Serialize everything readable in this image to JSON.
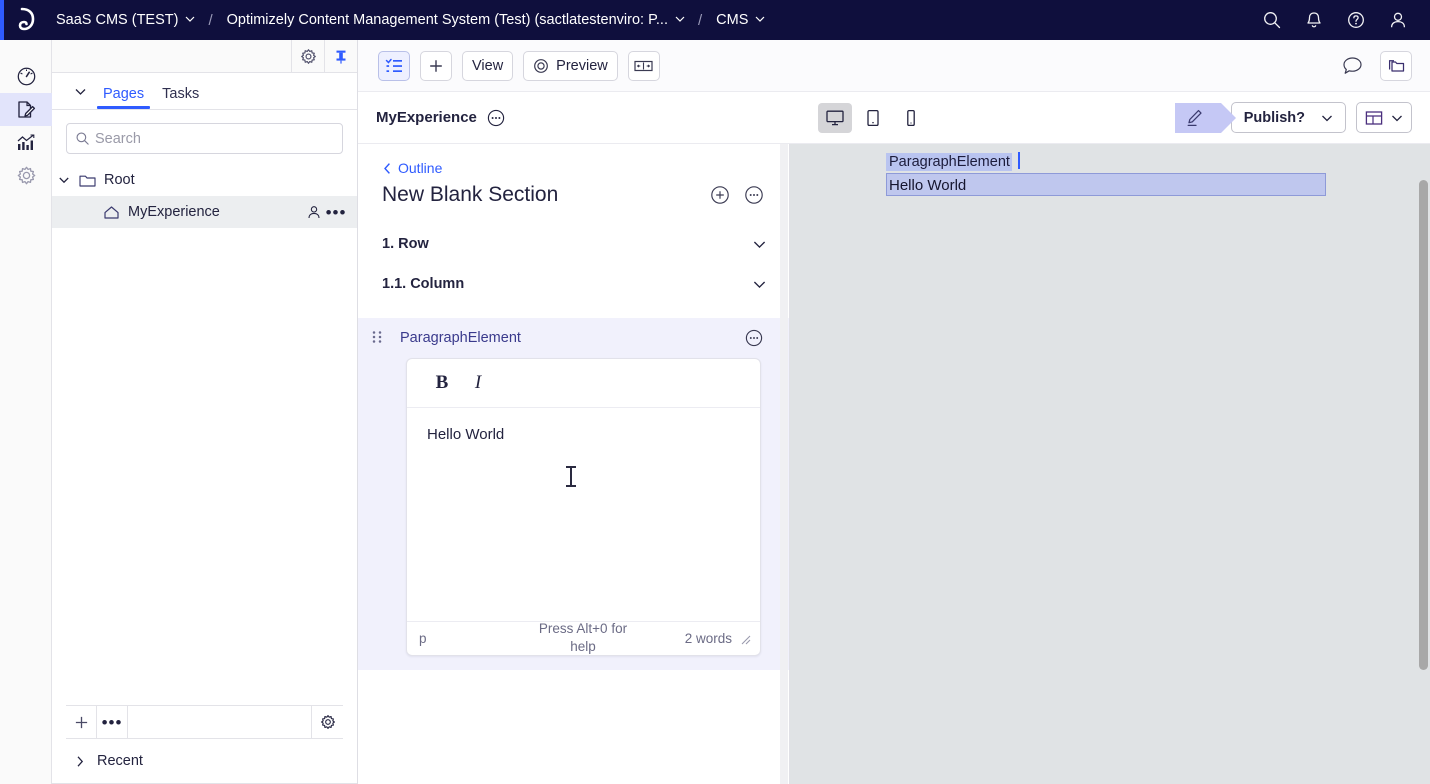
{
  "topbar": {
    "logo_icon": "optimizely-logo-icon",
    "breadcrumbs": [
      {
        "label": "SaaS CMS (TEST)",
        "has_chevron": true
      },
      {
        "label": "Optimizely Content Management System (Test) (sactlatestenviro: P...",
        "has_chevron": true
      },
      {
        "label": "CMS",
        "has_chevron": true
      }
    ],
    "separator": "/",
    "actions": [
      {
        "name": "search-icon",
        "label": "Search"
      },
      {
        "name": "notifications-icon",
        "label": "Notifications"
      },
      {
        "name": "help-icon",
        "label": "Help"
      },
      {
        "name": "user-account-icon",
        "label": "Account"
      }
    ]
  },
  "rail": {
    "items": [
      {
        "name": "dashboard-icon",
        "label": "Dashboard",
        "active": false
      },
      {
        "name": "content-edit-icon",
        "label": "Edit",
        "active": true
      },
      {
        "name": "analytics-icon",
        "label": "Analytics",
        "active": false
      },
      {
        "name": "settings-gear-icon",
        "label": "Settings",
        "active": false
      }
    ]
  },
  "sidebar": {
    "tools": [
      {
        "name": "panel-settings-icon",
        "label": "Settings"
      },
      {
        "name": "pin-panel-icon",
        "label": "Pin"
      }
    ],
    "tabs": [
      {
        "label": "Pages",
        "active": true
      },
      {
        "label": "Tasks",
        "active": false
      }
    ],
    "search": {
      "value": "",
      "placeholder": "Search"
    },
    "tree": [
      {
        "label": "Root",
        "icon": "folder-icon",
        "expanded": true,
        "selected": false,
        "depth": 0
      },
      {
        "label": "MyExperience",
        "icon": "home-icon",
        "selected": true,
        "depth": 1
      }
    ],
    "bottom_bar": {
      "add_label": "+",
      "more_label": "•••",
      "gear_name": "sidebar-gear-icon",
      "field_value": ""
    },
    "recent": {
      "label": "Recent",
      "expanded": false
    }
  },
  "editor": {
    "toolbar": {
      "outline_toggle": {
        "name": "outline-toggle-icon",
        "active": true
      },
      "add_label": "+",
      "view_label": "View",
      "preview_label": "Preview",
      "split_name": "split-view-icon",
      "comments_name": "comments-icon",
      "assets_name": "assets-panel-icon"
    },
    "subbar": {
      "title": "MyExperience",
      "title_menu": "•••",
      "devices": [
        {
          "name": "desktop-icon",
          "label": "Desktop",
          "active": true
        },
        {
          "name": "tablet-icon",
          "label": "Tablet",
          "active": false
        },
        {
          "name": "mobile-icon",
          "label": "Mobile",
          "active": false
        }
      ],
      "status_flag": {
        "name": "draft-pencil-icon",
        "label": "Draft"
      },
      "publish_label": "Publish?",
      "layout_name": "layout-panel-icon"
    }
  },
  "outline": {
    "back_label": "Outline",
    "section_title": "New Blank Section",
    "actions": [
      {
        "name": "add-circle-icon",
        "label": "Add"
      },
      {
        "name": "more-circle-icon",
        "label": "More"
      }
    ],
    "rows": [
      {
        "label": "1. Row"
      },
      {
        "label": "1.1. Column"
      }
    ],
    "element": {
      "name_label": "ParagraphElement",
      "drag_name": "drag-handle-icon",
      "menu_label": "•••",
      "rte": {
        "bold_label": "B",
        "italic_label": "I",
        "content": "Hello World",
        "path": "p",
        "help_text": "Press Alt+0 for help",
        "word_count": "2 words"
      }
    }
  },
  "preview": {
    "selected_label": "ParagraphElement",
    "content": "Hello World"
  },
  "colors": {
    "topbar_bg": "#0f0f3d",
    "accent_blue": "#2f5bff",
    "element_block_bg": "#f1f1fc",
    "selection_lavender": "#c5c8f5",
    "preview_bg": "#e0e3e5"
  }
}
